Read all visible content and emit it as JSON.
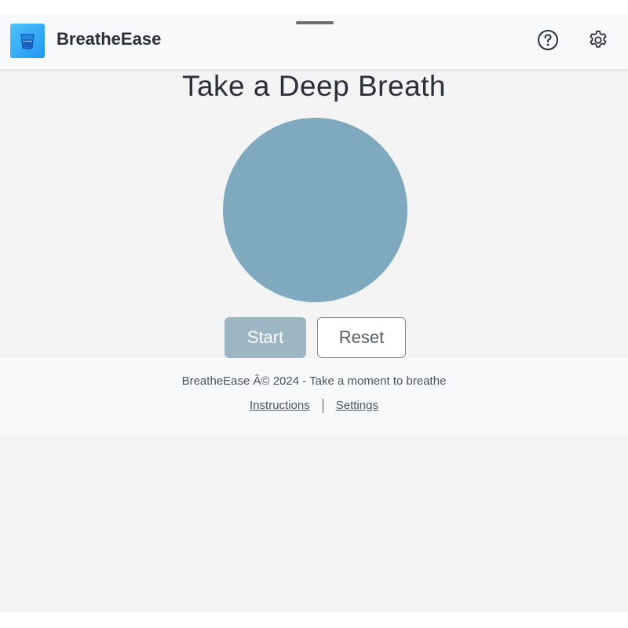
{
  "header": {
    "app_title": "BreatheEase",
    "logo_icon": "water-glass-icon",
    "help_icon": "help-circle-icon",
    "settings_icon": "gear-icon"
  },
  "main": {
    "title": "Take a Deep Breath",
    "circle_color": "#7fa9bf",
    "start_label": "Start",
    "reset_label": "Reset"
  },
  "footer": {
    "text": "BreatheEase Â© 2024 - Take a moment to breathe",
    "links": [
      "Instructions",
      "Settings"
    ]
  }
}
